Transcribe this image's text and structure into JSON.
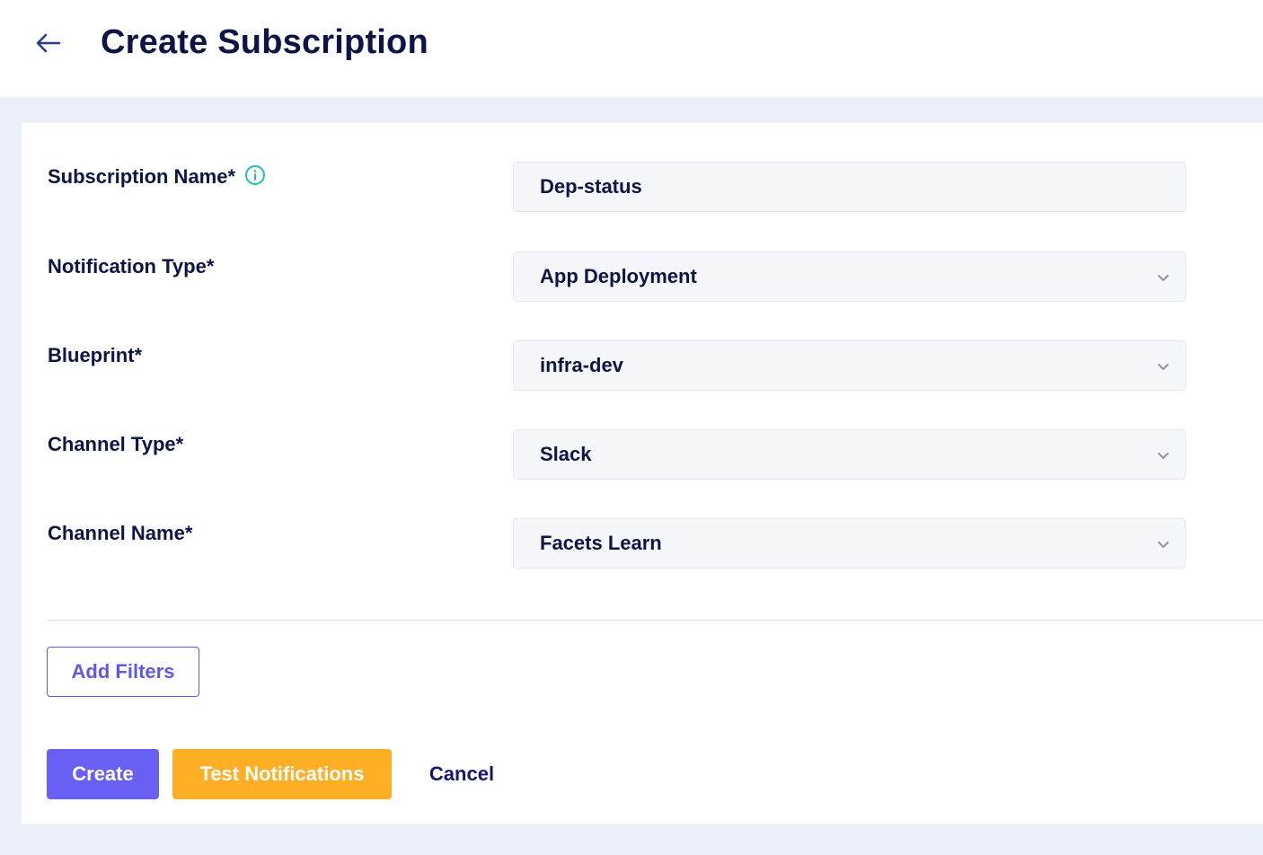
{
  "header": {
    "title": "Create Subscription",
    "back_icon": "arrow-left-icon"
  },
  "colors": {
    "primary": "#6860f5",
    "warning": "#ffaf26",
    "text": "#0d1547",
    "info": "#1fbfb4",
    "background": "#ebf0f8"
  },
  "form": {
    "subscription_name": {
      "label": "Subscription Name*",
      "value": "Dep-status",
      "info_icon": "info-icon"
    },
    "notification_type": {
      "label": "Notification Type*",
      "value": "App Deployment"
    },
    "blueprint": {
      "label": "Blueprint*",
      "value": "infra-dev"
    },
    "channel_type": {
      "label": "Channel Type*",
      "value": "Slack"
    },
    "channel_name": {
      "label": "Channel Name*",
      "value": "Facets Learn"
    }
  },
  "buttons": {
    "add_filters": "Add Filters",
    "create": "Create",
    "test_notifications": "Test Notifications",
    "cancel": "Cancel"
  }
}
